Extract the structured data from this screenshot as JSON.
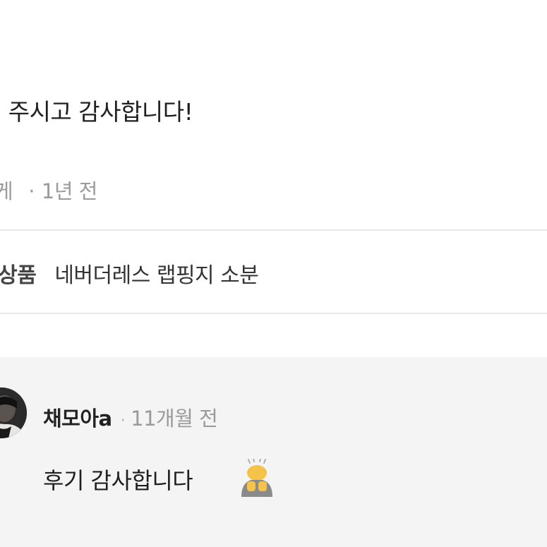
{
  "review": {
    "text": "많이 주시고 감사합니다!",
    "meta_author_fragment": "게",
    "meta_separator": "·",
    "meta_time": "1년 전"
  },
  "product": {
    "label": "래상품",
    "name": "네버더레스 랩핑지 소분"
  },
  "reply": {
    "author": "채모아a",
    "separator": "·",
    "time": "11개월 전",
    "text": "후기 감사합니다",
    "emoji_icon": "person-bowing-icon"
  },
  "colors": {
    "reply_background": "#f4f4f4",
    "divider": "#e8e8e8",
    "meta_text": "#9a9a9a"
  }
}
